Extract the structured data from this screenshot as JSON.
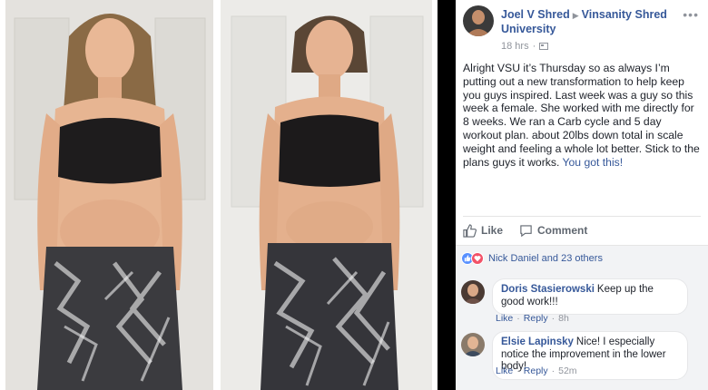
{
  "post": {
    "author": "Joel V Shred",
    "group": "Vinsanity Shred University",
    "time": "18 hrs",
    "more": "•••",
    "text": "Alright VSU it’s Thursday so as always I’m putting out a new transformation to help keep you guys inspired. Last week was a guy so this week a female. She worked with me directly for 8 weeks. We ran a Carb cycle and 5 day workout plan. about 20lbs down total in scale weight and feeling a whole lot better. Stick to the plans guys it works.",
    "text_link": "You got this!"
  },
  "actions": {
    "like": "Like",
    "comment": "Comment"
  },
  "reactions": {
    "label": "Nick Daniel and 23 others"
  },
  "comments": [
    {
      "name": "Doris Stasierowski",
      "text": "Keep up the good work!!!",
      "like": "Like",
      "reply": "Reply",
      "time": "8h"
    },
    {
      "name": "Elsie Lapinsky",
      "text": "Nice! I especially notice the improvement in the lower body!",
      "like": "Like",
      "reply": "Reply",
      "time": "52m"
    }
  ],
  "colors": {
    "link": "#365899",
    "muted": "#90949c",
    "feedback_bg": "#f2f3f5",
    "like_blue": "#5890ff",
    "love_red": "#f25268"
  }
}
